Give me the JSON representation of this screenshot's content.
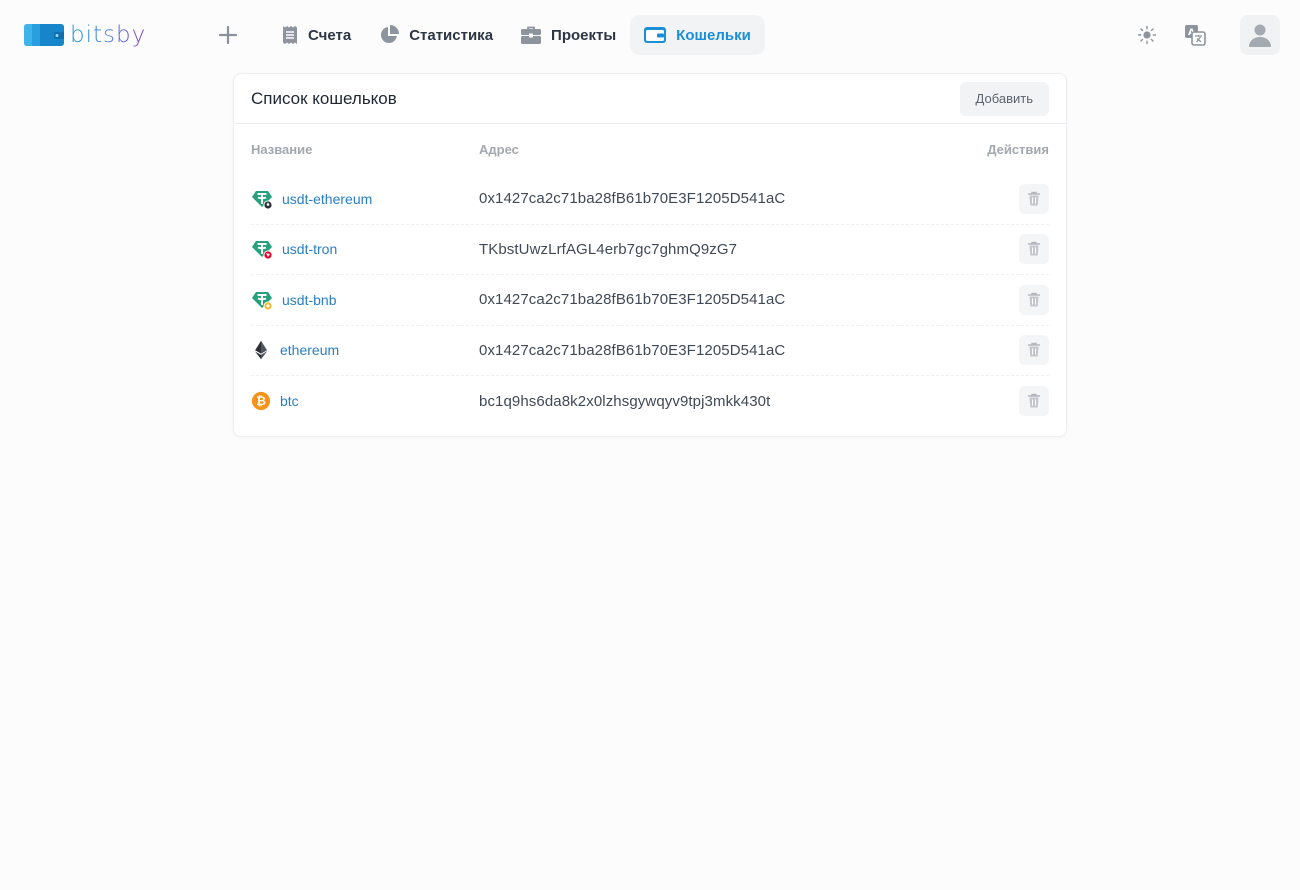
{
  "app": {
    "logo_text": "bitsby"
  },
  "nav": {
    "items": [
      {
        "label": "Счета",
        "icon": "receipt-icon",
        "active": false
      },
      {
        "label": "Статистика",
        "icon": "pie-chart-icon",
        "active": false
      },
      {
        "label": "Проекты",
        "icon": "briefcase-icon",
        "active": false
      },
      {
        "label": "Кошельки",
        "icon": "wallet-icon",
        "active": true
      }
    ]
  },
  "card": {
    "title": "Список кошельков",
    "add_label": "Добавить"
  },
  "table": {
    "columns": [
      "Название",
      "Адрес",
      "Действия"
    ],
    "rows": [
      {
        "name": "usdt-ethereum",
        "address": "0x1427ca2c71ba28fB61b70E3F1205D541aC",
        "icon": "usdt-ethereum-icon"
      },
      {
        "name": "usdt-tron",
        "address": "TKbstUwzLrfAGL4erb7gc7ghmQ9zG7",
        "icon": "usdt-tron-icon"
      },
      {
        "name": "usdt-bnb",
        "address": "0x1427ca2c71ba28fB61b70E3F1205D541aC",
        "icon": "usdt-bnb-icon"
      },
      {
        "name": "ethereum",
        "address": "0x1427ca2c71ba28fB61b70E3F1205D541aC",
        "icon": "ethereum-icon"
      },
      {
        "name": "btc",
        "address": "bc1q9hs6da8k2x0lzhsgywqyv9tpj3mkk430t",
        "icon": "bitcoin-icon"
      }
    ]
  },
  "colors": {
    "accent": "#1a8fd8",
    "link": "#2a7fc4",
    "tether": "#26a17b",
    "bitcoin": "#f7931a",
    "tron": "#eb0029",
    "bnb": "#f3ba2f"
  }
}
